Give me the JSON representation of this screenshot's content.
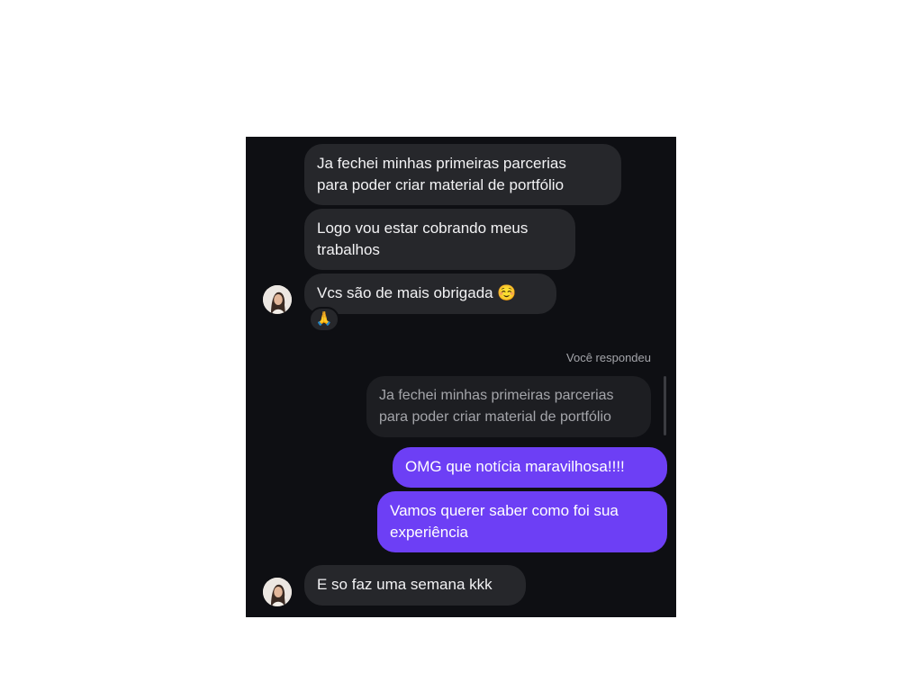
{
  "messages": {
    "m1": "Ja fechei minhas primeiras parcerias\npara poder criar material de portfólio",
    "m2": "Logo vou estar cobrando meus\ntrabalhos",
    "m3": "Vcs são de mais obrigada ☺️",
    "m3_reaction": "🙏",
    "reply_label": "Você respondeu",
    "quoted": "Ja fechei minhas primeiras parcerias\npara poder criar material de portfólio",
    "s1": "OMG que notícia maravilhosa!!!!",
    "s2": "Vamos querer saber como foi sua\nexperiência",
    "m4": "E so faz uma semana kkk"
  },
  "colors": {
    "background": "#0e0f13",
    "received_bubble": "#26272b",
    "sent_bubble": "#6d3ff5"
  },
  "icons": {
    "avatar": "user-avatar",
    "reaction": "folded-hands-emoji"
  }
}
